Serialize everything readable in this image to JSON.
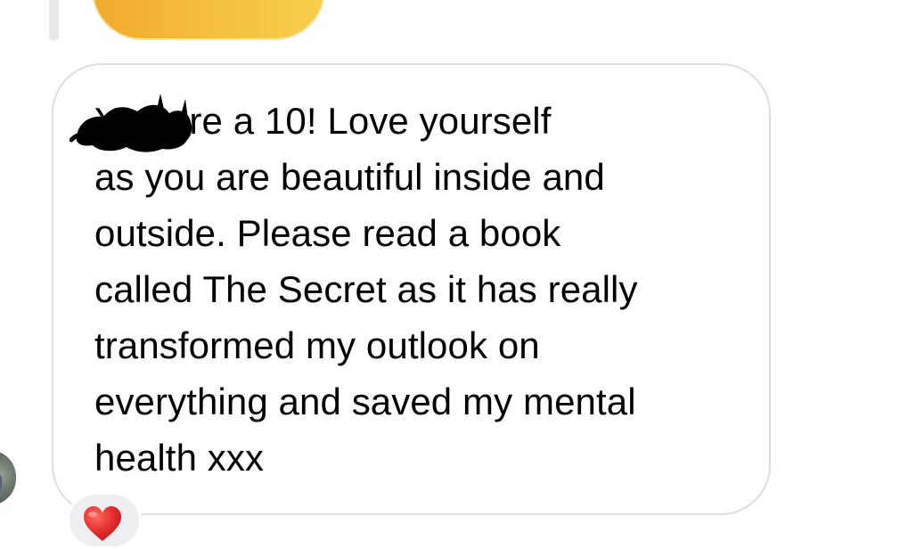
{
  "message": {
    "text": "You are a 10! Love yourself\nas you are beautiful inside and\noutside. Please read a book\ncalled The Secret as it has really\ntransformed my outlook on\neverything and saved my mental\nhealth xxx",
    "redaction": {
      "icon": "redaction-scribble",
      "color": "#000000"
    }
  },
  "reaction": {
    "icon": "red-heart-icon",
    "color": "#e22d2d"
  },
  "previous_message": {
    "gradient_colors": [
      "#f1ab2c",
      "#f6cf4b"
    ]
  },
  "avatar": {
    "icon": "user-avatar"
  },
  "colors": {
    "bubble_border": "#dededf",
    "background": "#ffffff",
    "reaction_pill": "#efeff1"
  }
}
